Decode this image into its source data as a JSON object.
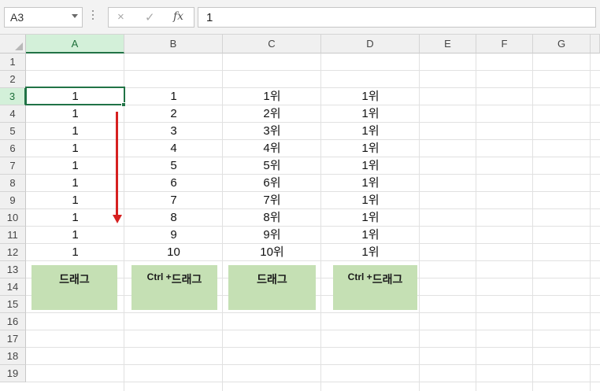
{
  "formula_bar": {
    "name_box": "A3",
    "cancel_icon": "×",
    "enter_icon": "✓",
    "function_icon": "fx",
    "value": "1"
  },
  "columns": [
    "A",
    "B",
    "C",
    "D",
    "E",
    "F",
    "G"
  ],
  "rows": [
    "1",
    "2",
    "3",
    "4",
    "5",
    "6",
    "7",
    "8",
    "9",
    "10",
    "11",
    "12",
    "13",
    "14",
    "15",
    "16",
    "17",
    "18",
    "19"
  ],
  "cells": {
    "A": [
      "1",
      "1",
      "1",
      "1",
      "1",
      "1",
      "1",
      "1",
      "1",
      "1"
    ],
    "B": [
      "1",
      "2",
      "3",
      "4",
      "5",
      "6",
      "7",
      "8",
      "9",
      "10"
    ],
    "C": [
      "1위",
      "2위",
      "3위",
      "4위",
      "5위",
      "6위",
      "7위",
      "8위",
      "9위",
      "10위"
    ],
    "D": [
      "1위",
      "1위",
      "1위",
      "1위",
      "1위",
      "1위",
      "1위",
      "1위",
      "1위",
      "1위"
    ]
  },
  "shapes": {
    "a": "드래그",
    "b_prefix": "Ctrl + ",
    "b_suffix": "드래그",
    "c": "드래그",
    "d_prefix": "Ctrl + ",
    "d_suffix": "드래그"
  },
  "colors": {
    "accent": "#217346",
    "arrow": "#d62020",
    "shape_fill": "#c5e0b4"
  }
}
